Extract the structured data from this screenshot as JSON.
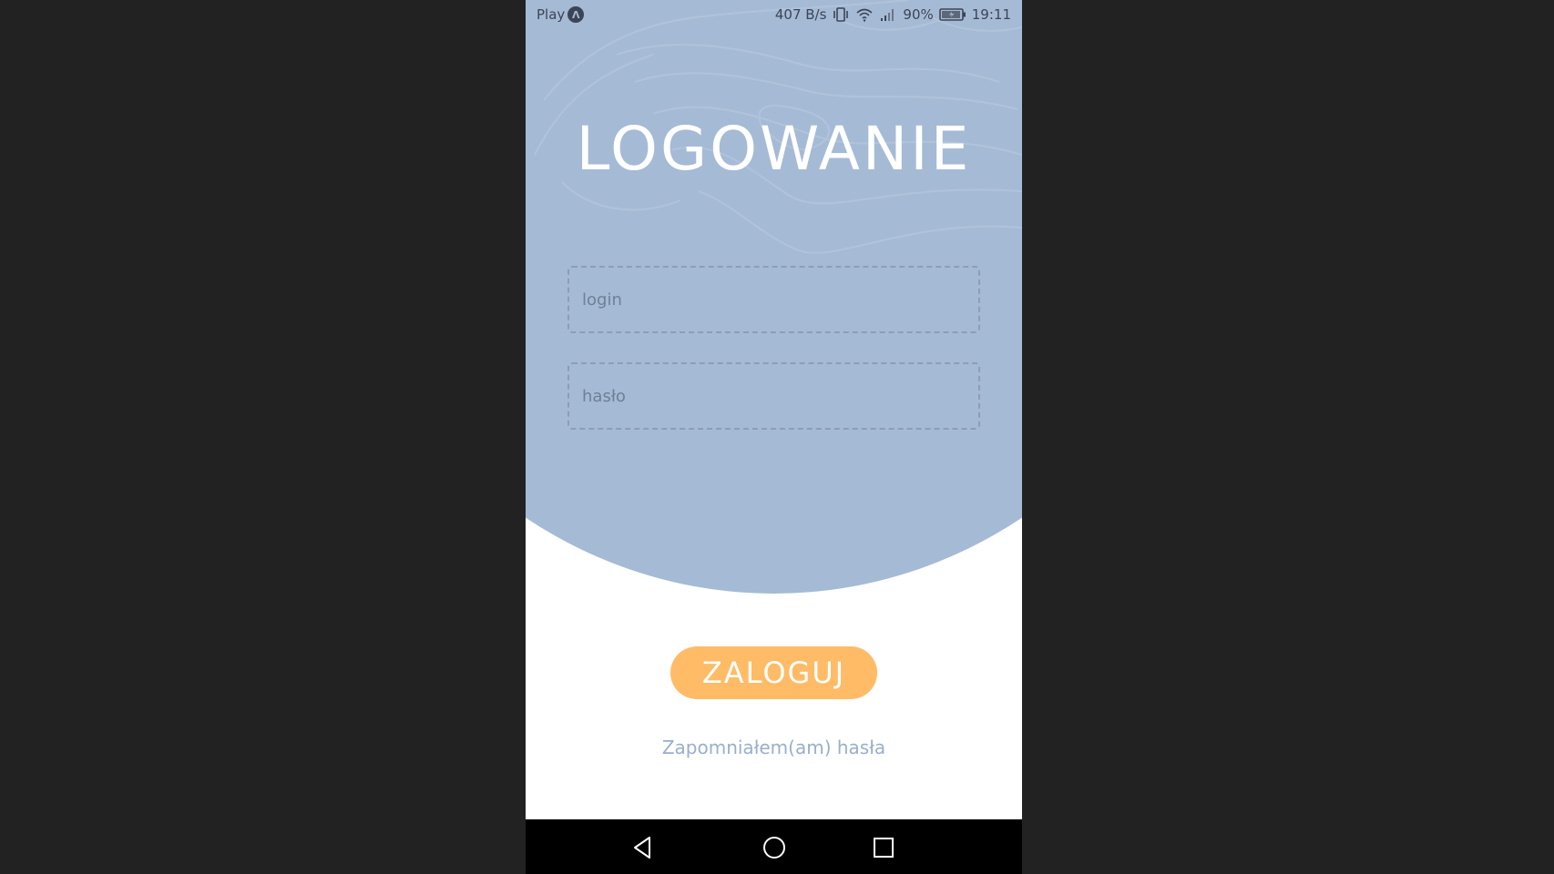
{
  "status_bar": {
    "carrier": "Play",
    "carrier_badge": "Λ",
    "net_speed": "407 B/s",
    "battery": "90%",
    "time": "19:11"
  },
  "login_screen": {
    "title": "LOGOWANIE",
    "login_placeholder": "login",
    "password_placeholder": "hasło",
    "submit_label": "ZALOGUJ",
    "forgot_link": "Zapomniałem(am) hasła"
  },
  "colors": {
    "background": "#222222",
    "blob": "#a5bad5",
    "button": "#ffbb66",
    "link": "#9aafca"
  },
  "nav_bar": {
    "icons": [
      "back-icon",
      "home-icon",
      "recent-apps-icon"
    ]
  }
}
